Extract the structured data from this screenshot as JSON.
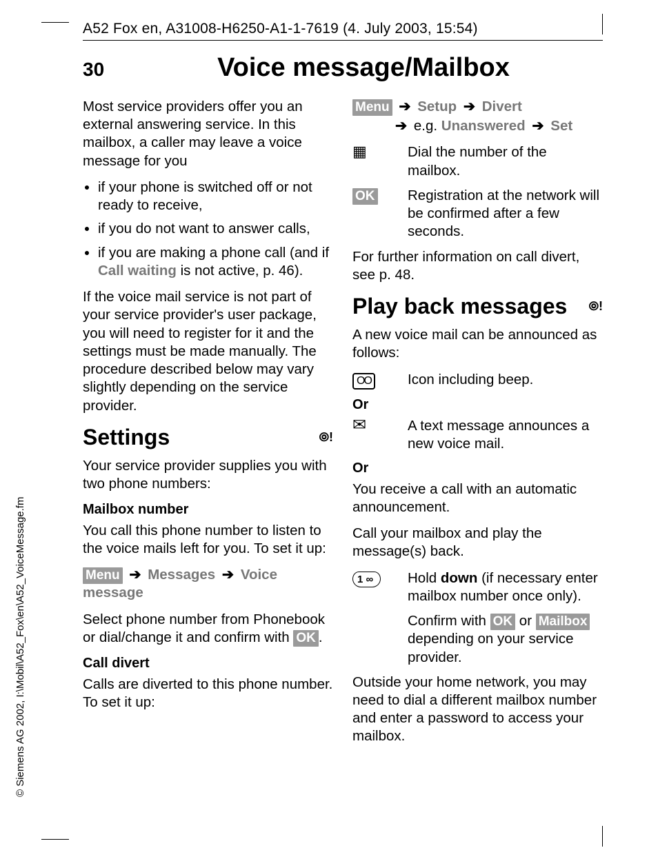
{
  "header": "A52 Fox en, A31008-H6250-A1-1-7619 (4. July 2003, 15:54)",
  "page_number": "30",
  "page_title": "Voice message/Mailbox",
  "copyright": "© Siemens AG 2002, I:\\Mobil\\A52_Fox\\en\\A52_VoiceMessage.fm",
  "left": {
    "intro": "Most service providers offer you an external answering service. In this mailbox, a caller may leave a voice message for you",
    "bullets": {
      "b1": "if your phone is switched off or not ready to receive,",
      "b2": "if you do not want to answer calls,",
      "b3_pre": "if you are making a phone call (and if ",
      "b3_bold": "Call waiting",
      "b3_post": " is not active, p. 46)."
    },
    "para2": "If the voice mail service is not part of your service provider's user package, you will need to register for it and the settings must be made manually. The procedure described below may vary slightly depending on the service provider.",
    "settings_heading": "Settings",
    "settings_intro": "Your service provider supplies you with two phone numbers:",
    "mailbox_num_h": "Mailbox number",
    "mailbox_num_p": "You call this phone number to listen to the voice mails left for you. To set it up:",
    "menu_label": "Menu",
    "msgs": "Messages",
    "vm": "Voice message",
    "select_p_pre": "Select phone number from Phonebook or dial/change it and confirm with ",
    "select_p_post": ".",
    "ok_label": "OK",
    "call_divert_h": "Call divert",
    "call_divert_p": "Calls are diverted to this phone number. To set it up:"
  },
  "right": {
    "menu_label": "Menu",
    "setup": "Setup",
    "divert": "Divert",
    "eg": "e.g.",
    "unanswered": "Unanswered",
    "set": "Set",
    "dial_p": "Dial the number of the mailbox.",
    "ok_label": "OK",
    "reg_p": "Registration at the network will be confirmed after a few seconds.",
    "further": "For further information on call divert, see p. 48.",
    "play_heading": "Play back messages",
    "announce": "A new voice mail can be announced as follows:",
    "icon_beep": "Icon including beep.",
    "or1": "Or",
    "sms_p": "A text message announces a new voice mail.",
    "or2": "Or",
    "auto_p": "You receive a call with an automatic announcement.",
    "call_p": "Call your mailbox and play the message(s) back.",
    "key_label": "1 ∞",
    "hold_pre": "Hold ",
    "hold_bold": "down",
    "hold_post": " (if necessary enter mailbox number once only).",
    "confirm_pre": "Confirm with ",
    "confirm_mid": " or ",
    "mailbox_chip": "Mailbox",
    "confirm_post": " depending on your service provider.",
    "outside": "Outside your home network, you may need to dial a different mailbox number and enter a password to access your mailbox."
  },
  "icons": {
    "net": "⦾!",
    "keypad": "▦",
    "vm": "OO",
    "env": "✉",
    "arrow": "➔"
  }
}
